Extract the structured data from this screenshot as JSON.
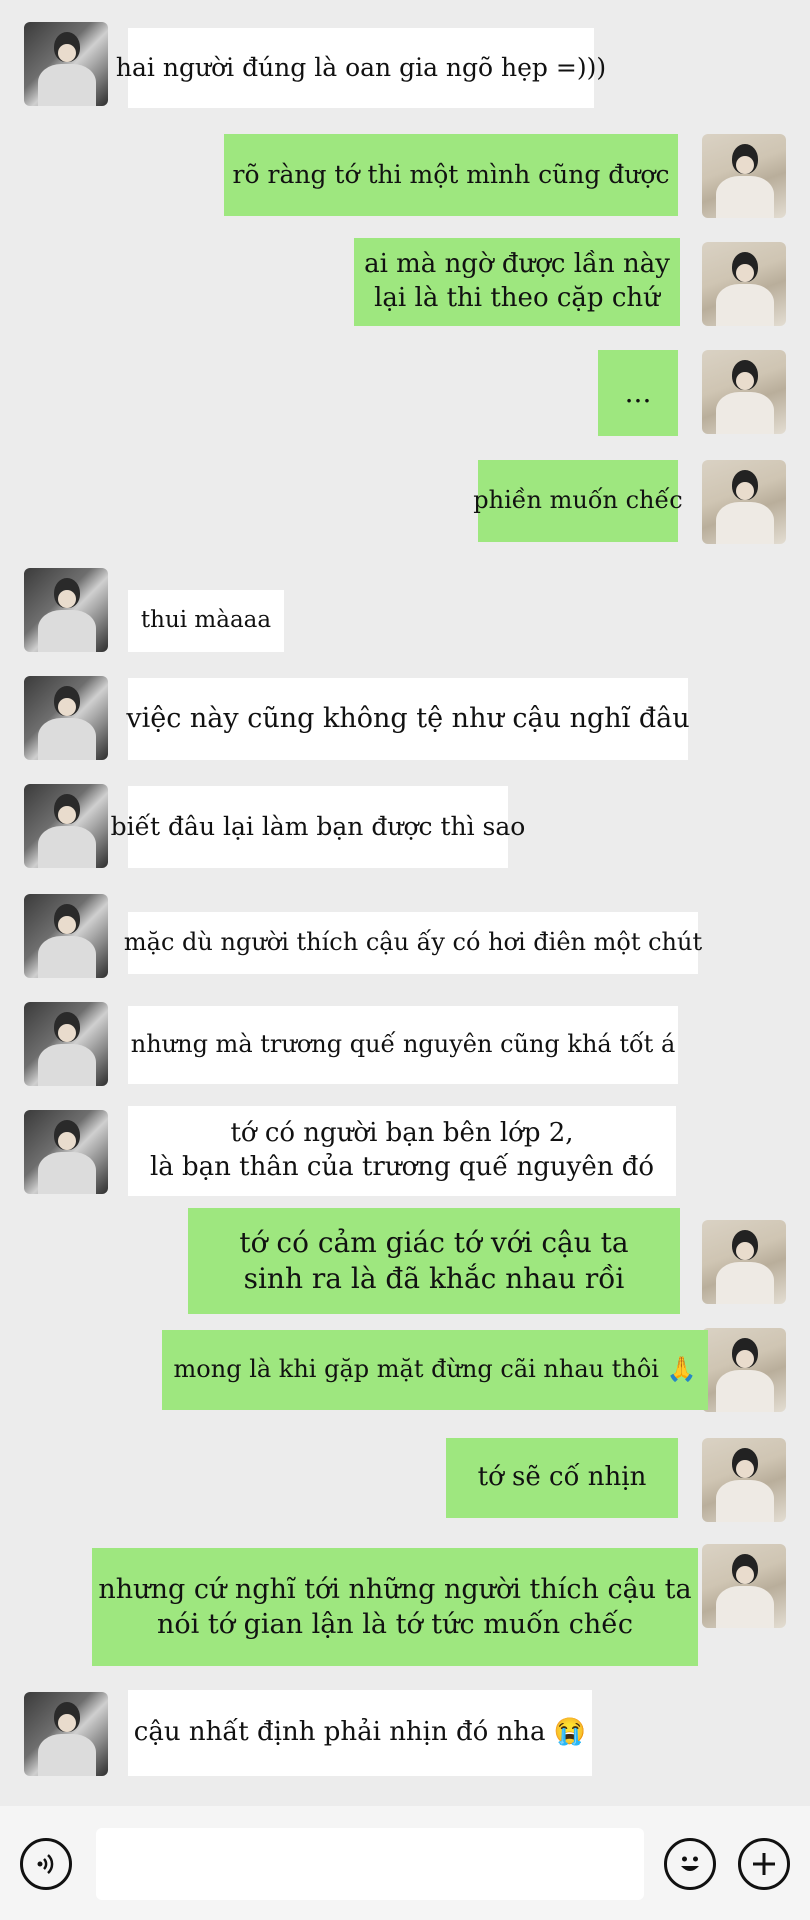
{
  "messages": [
    {
      "side": "in",
      "lines": [
        "hai người đúng là oan gia ngõ hẹp =)))"
      ]
    },
    {
      "side": "out",
      "lines": [
        "rõ ràng tớ thi một mình cũng được"
      ]
    },
    {
      "side": "out",
      "lines": [
        "ai mà ngờ được lần này",
        "lại là thi theo cặp chứ"
      ]
    },
    {
      "side": "out",
      "lines": [
        "..."
      ]
    },
    {
      "side": "out",
      "lines": [
        "phiền muốn chếc"
      ]
    },
    {
      "side": "in",
      "lines": [
        "thui màaaa"
      ]
    },
    {
      "side": "in",
      "lines": [
        "việc này cũng không tệ như cậu nghĩ đâu"
      ]
    },
    {
      "side": "in",
      "lines": [
        "biết đâu lại làm bạn được thì sao"
      ]
    },
    {
      "side": "in",
      "lines": [
        "mặc dù người thích cậu ấy có hơi điên một chút"
      ]
    },
    {
      "side": "in",
      "lines": [
        "nhưng mà trương quế nguyên cũng khá tốt á"
      ]
    },
    {
      "side": "in",
      "lines": [
        "tớ có người bạn bên lớp 2,",
        "là bạn thân của trương quế nguyên đó"
      ]
    },
    {
      "side": "out",
      "lines": [
        "tớ có cảm giác tớ với cậu ta",
        "sinh ra là đã khắc nhau rồi"
      ]
    },
    {
      "side": "out",
      "lines": [
        "mong là khi gặp mặt đừng cãi nhau thôi 🙏"
      ]
    },
    {
      "side": "out",
      "lines": [
        "tớ sẽ cố nhịn"
      ]
    },
    {
      "side": "out",
      "lines": [
        "nhưng cứ nghĩ tới những người thích cậu ta",
        "nói tớ gian lận là tớ tức muốn chếc"
      ]
    },
    {
      "side": "in",
      "lines": [
        "cậu nhất định phải nhịn đó nha 😭"
      ]
    }
  ],
  "composer": {
    "voice_icon": "voice-icon",
    "emoji_icon": "emoji-icon",
    "add_icon": "add-icon",
    "input_value": ""
  },
  "colors": {
    "incoming": "#ffffff",
    "outgoing": "#9ee77f",
    "background": "#ececec"
  }
}
